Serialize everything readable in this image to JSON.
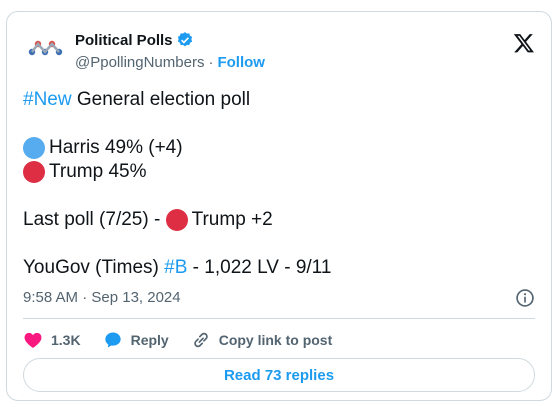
{
  "author": {
    "name": "Political Polls",
    "handle": "@PpollingNumbers",
    "follow_label": "Follow",
    "separator": "·",
    "verified_color": "#1d9bf0"
  },
  "tweet": {
    "lines": [
      {
        "hashtag": "#New",
        "text": " General election poll"
      },
      {
        "text": "Harris 49% (+4)",
        "icon": "blue-circle"
      },
      {
        "text": "Trump 45%",
        "icon": "red-circle"
      },
      {
        "prefix": "Last poll (7/25) - ",
        "text": "Trump +2",
        "icon": "red-circle"
      },
      {
        "prefix": "YouGov (Times) ",
        "hashtag": "#B",
        "text": " - 1,022 LV - 9/11"
      }
    ],
    "timestamp": "9:58 AM · Sep 13, 2024"
  },
  "actions": {
    "likes": "1.3K",
    "reply_label": "Reply",
    "copy_label": "Copy link to post"
  },
  "read_replies_label": "Read 73 replies",
  "colors": {
    "accent": "#1d9bf0",
    "like": "#f91880",
    "reply": "#1d9bf0",
    "blue_circle": "#56acee",
    "red_circle": "#dd2e44"
  }
}
